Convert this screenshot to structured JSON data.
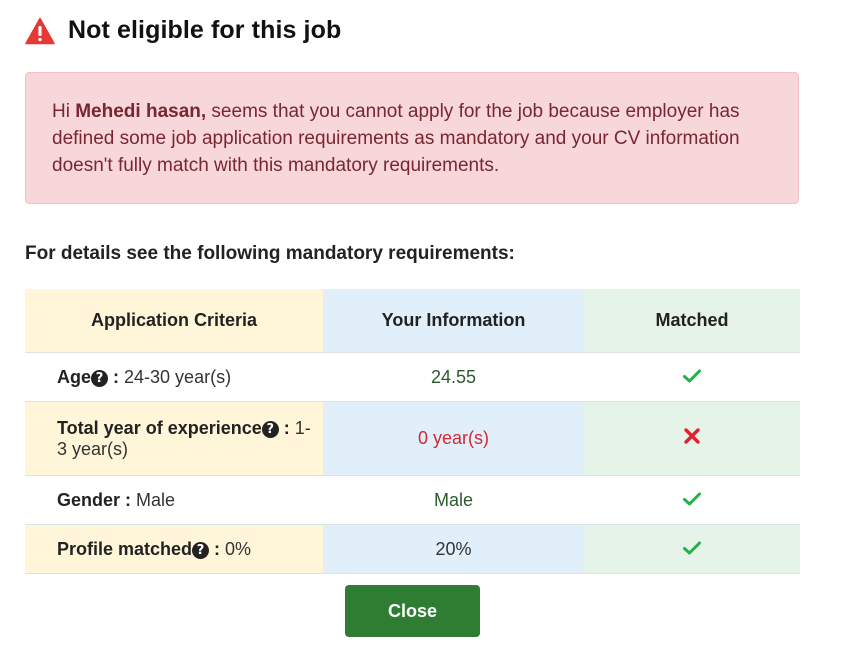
{
  "dialog": {
    "title": "Not eligible for this job",
    "icon": "warning-triangle-icon"
  },
  "alert": {
    "greeting": "Hi ",
    "user_name": "Mehedi hasan,",
    "message": " seems that you cannot apply for the job because employer has defined some job application requirements as mandatory and your CV information doesn't fully match with this mandatory requirements."
  },
  "requirements": {
    "heading": "For details see the following mandatory requirements:",
    "columns": [
      "Application Criteria",
      "Your Information",
      "Matched"
    ],
    "rows": [
      {
        "label": "Age",
        "has_help": true,
        "separator": " : ",
        "requirement": "24-30 year(s)",
        "your_info": "24.55",
        "matched": true
      },
      {
        "label": "Total year of experience",
        "has_help": true,
        "separator": " : ",
        "requirement": "1-3 year(s)",
        "your_info": "0 year(s)",
        "matched": false
      },
      {
        "label": "Gender",
        "has_help": false,
        "separator": " : ",
        "requirement": "Male",
        "your_info": "Male",
        "matched": true
      },
      {
        "label": "Profile matched",
        "has_help": true,
        "separator": " : ",
        "requirement": "0%",
        "your_info": "20%",
        "matched": true
      }
    ]
  },
  "actions": {
    "close_label": "Close"
  },
  "colors": {
    "danger": "#e53935",
    "success": "#2e7d32",
    "check": "#22b14c",
    "cross": "#e3202f",
    "alert_bg": "#f8d7da"
  }
}
